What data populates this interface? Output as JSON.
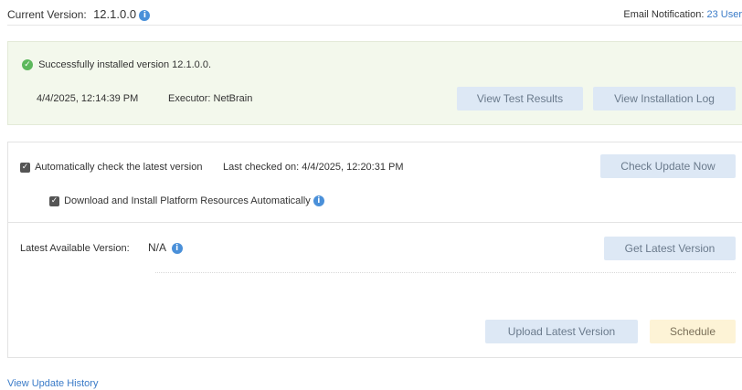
{
  "header": {
    "current_version_label": "Current Version:",
    "current_version_value": "12.1.0.0",
    "email_label": "Email Notification:",
    "email_value": "23 User"
  },
  "install_status": {
    "message": "Successfully installed version 12.1.0.0.",
    "timestamp": "4/4/2025, 12:14:39 PM",
    "executor": "Executor: NetBrain",
    "view_test_results": "View Test Results",
    "view_installation_log": "View Installation Log"
  },
  "auto_check": {
    "checkbox_label": "Automatically check the latest version",
    "checked": true,
    "last_checked": "Last checked on: 4/4/2025, 12:20:31 PM",
    "check_update_now": "Check Update Now",
    "download_label": "Download and Install Platform Resources Automatically",
    "download_checked": true
  },
  "latest": {
    "label": "Latest Available Version:",
    "value": "N/A",
    "get_latest": "Get Latest Version",
    "upload_latest": "Upload Latest Version",
    "schedule": "Schedule"
  },
  "footer": {
    "history_link": "View Update History"
  },
  "colors": {
    "success_bg": "#f3f8ec",
    "button_bg": "#dde8f5",
    "schedule_bg": "#fdf3d6",
    "link": "#3a7bc8",
    "info": "#4a90d9",
    "success_icon": "#5cb85c"
  }
}
